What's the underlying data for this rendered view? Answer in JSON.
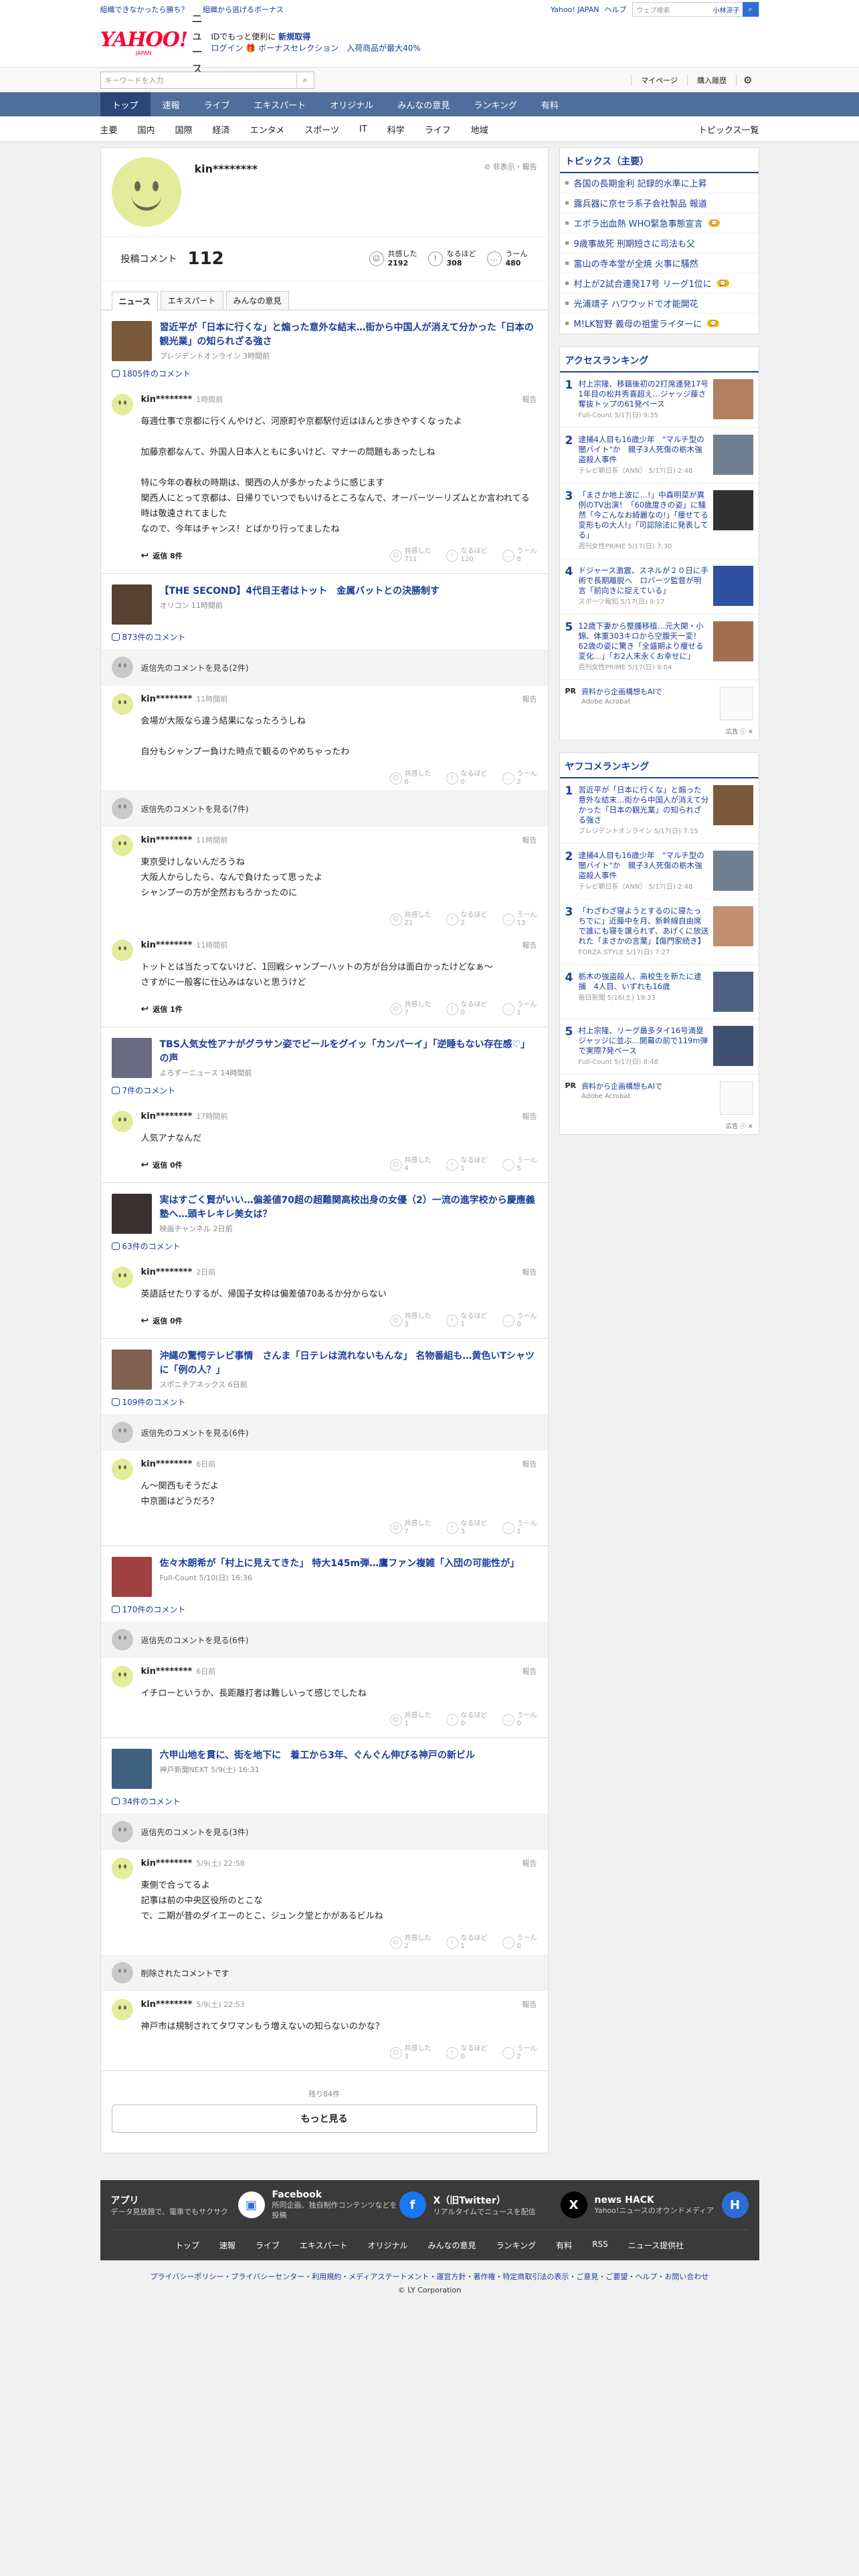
{
  "top": {
    "links": [
      "組織できなかったら勝ち？",
      "組織から逃げるボーナス"
    ],
    "yj": "Yahoo! JAPAN",
    "help": "ヘルプ",
    "search_placeholder": "ウェブ検索",
    "user": "小林涼子"
  },
  "header": {
    "logo": "YAHOO!",
    "logo_sub": "JAPAN",
    "news": "ニュース",
    "promo1": "IDでもっと便利に",
    "promo1b": "新規取得",
    "promo2": "ログイン 🎁 ボーナスセレクション　入荷商品が最大40%"
  },
  "search": {
    "placeholder": "キーワードを入力",
    "mypage": "マイページ",
    "history": "購入履歴"
  },
  "nav": [
    "トップ",
    "速報",
    "ライブ",
    "エキスパート",
    "オリジナル",
    "みんなの意見",
    "ランキング",
    "有料"
  ],
  "subnav": [
    "主要",
    "国内",
    "国際",
    "経済",
    "エンタメ",
    "スポーツ",
    "IT",
    "科学",
    "ライフ",
    "地域"
  ],
  "subnav_all": "トピックス一覧",
  "profile": {
    "name": "kin********",
    "report": "非表示・報告",
    "comments_label": "投稿コメント",
    "comments": "112",
    "r1": "共感した",
    "r1n": "2192",
    "r2": "なるほど",
    "r2n": "308",
    "r3": "うーん",
    "r3n": "480"
  },
  "tabs": [
    "ニュース",
    "エキスパート",
    "みんなの意見"
  ],
  "articles": [
    {
      "title": "習近平が「日本に行くな」と煽った意外な結末…街から中国人が消えて分かった「日本の観光業」の知られざる強さ",
      "src": "プレジデントオンライン 3時間前",
      "count": "1805件のコメント",
      "thumb": "#7a5a3a",
      "comments": [
        {
          "name": "kin********",
          "time": "1時間前",
          "text": "毎週仕事で京都に行くんやけど、河原町や京都駅付近はほんと歩きやすくなったよ\n\n加藤京都なんて、外国人日本人ともに多いけど、マナーの問題もあったしね\n\n特に今年の春秋の時期は、関西の人が多かったように感じます\n関西人にとって京都は、日帰りでいつでもいけるところなんで、オーバーツーリズムとか言われてる時は敬遠されてました\nなので、今年はチャンス！とばかり行ってましたね",
          "reply": "返信 8件",
          "r": [
            "711",
            "120",
            "8"
          ]
        }
      ]
    },
    {
      "title": "【THE SECOND】4代目王者はトット　金属バットとの決勝制す",
      "src": "オリコン 11時間前",
      "count": "873件のコメント",
      "thumb": "#5a4030",
      "more": "返信先のコメントを見る(2件)",
      "comments": [
        {
          "name": "kin********",
          "time": "11時間前",
          "text": "会場が大阪なら違う結果になったろうしね\n\n自分もシャンプー負けた時点で観るのやめちゃったわ",
          "reply": "",
          "r": [
            "6",
            "0",
            "2"
          ]
        }
      ],
      "more2": "返信先のコメントを見る(7件)",
      "comments2": [
        {
          "name": "kin********",
          "time": "11時間前",
          "text": "東京受けしないんだろうね\n大阪人からしたら、なんで負けたって思ったよ\nシャンプーの方が全然おもろかったのに",
          "reply": "",
          "r": [
            "21",
            "2",
            "13"
          ]
        },
        {
          "name": "kin********",
          "time": "11時間前",
          "text": "トットとは当たってないけど、1回戦シャンプーハットの方が台分は面白かったけどなぁ〜\nさすがに一般客に仕込みはないと思うけど",
          "reply": "返信 1件",
          "r": [
            "7",
            "0",
            "1"
          ]
        }
      ]
    },
    {
      "title": "TBS人気女性アナがグラサン姿でビールをグイッ「カンパーイ」「逆睡もない存在感♡」の声",
      "src": "よろずーニュース 14時間前",
      "count": "7件のコメント",
      "thumb": "#6a6a80",
      "comments": [
        {
          "name": "kin********",
          "time": "17時間前",
          "text": "人気アナなんだ",
          "reply": "返信 0件",
          "r": [
            "4",
            "1",
            "5"
          ]
        }
      ]
    },
    {
      "title": "実はすごく賢がいい…偏差値70超の超難関高校出身の女優（2）一流の進学校から慶應義塾へ…頭キレキレ美女は？",
      "src": "映画チャンネル 2日前",
      "count": "63件のコメント",
      "thumb": "#3a3030",
      "comments": [
        {
          "name": "kin********",
          "time": "2日前",
          "text": "英語話せたりするが、帰国子女枠は偏差値70あるか分からない",
          "reply": "返信 0件",
          "r": [
            "3",
            "1",
            "0"
          ]
        }
      ]
    },
    {
      "title": "沖縄の驚愕テレビ事情　さんま「日テレは流れないもんな」 名物番組も…黄色いTシャツに「例の人？」",
      "src": "スポニチアネックス 6日前",
      "count": "109件のコメント",
      "thumb": "#806050",
      "more": "返信先のコメントを見る(6件)",
      "comments": [
        {
          "name": "kin********",
          "time": "6日前",
          "text": "ん〜関西もそうだよ\n中京圏はどうだろ？",
          "reply": "",
          "r": [
            "7",
            "3",
            "1"
          ]
        }
      ]
    },
    {
      "title": "佐々木朗希が「村上に見えてきた」 特大145m弾…鷹ファン複雑「入団の可能性が」",
      "src": "Full-Count 5/10(日) 16:36",
      "count": "170件のコメント",
      "thumb": "#a04040",
      "more": "返信先のコメントを見る(6件)",
      "comments": [
        {
          "name": "kin********",
          "time": "6日前",
          "text": "イチローというか、長距離打者は難しいって感じでしたね",
          "reply": "",
          "r": [
            "1",
            "0",
            "0"
          ]
        }
      ]
    },
    {
      "title": "六甲山地を貫に、街を地下に　着工から3年、ぐんぐん伸びる神戸の新ビル",
      "src": "神戸新聞NEXT 5/9(土) 16:31",
      "count": "34件のコメント",
      "thumb": "#406080",
      "more": "返信先のコメントを見る(3件)",
      "comments": [
        {
          "name": "kin********",
          "time": "5/9(土) 22:58",
          "text": "東側で合ってるよ\n記事は前の中央区役所のとこな\nで、二期が昔のダイエーのとこ、ジュンク堂とかがあるビルね",
          "reply": "",
          "r": [
            "2",
            "1",
            "0"
          ]
        }
      ],
      "deleted": "削除されたコメントです",
      "comments2": [
        {
          "name": "kin********",
          "time": "5/9(土) 22:53",
          "text": "神戸市は規制されてタワマンもう増えないの知らないのかな？",
          "reply": "",
          "r": [
            "3",
            "0",
            "2"
          ]
        }
      ]
    }
  ],
  "rx": [
    "共感した",
    "なるほど",
    "うーん"
  ],
  "loadmore": {
    "rest": "残り84件",
    "btn": "もっと見る"
  },
  "side": {
    "topics_title": "トピックス（主要）",
    "topics": [
      "各国の長期金利 記録的水準に上昇",
      "露兵器に京セラ系子会社製品 報道",
      "エボラ出血熱 WHO緊急事態宣言",
      "9歳事故死 刑期短さに司法も父",
      "富山の寺本堂が全焼 火事に騒然",
      "村上が2試合連発17号 リーグ1位に",
      "光浦靖子 ハワウッドで才能開花",
      "M!LK智野 義母の祖霊ライターに"
    ],
    "badges": [
      2,
      5,
      7
    ],
    "access_title": "アクセスランキング",
    "access": [
      {
        "t": "村上宗隆、移籍後初の2打席連発17号　1年目の松井秀喜超え…ジャッジ藤さ奪抜トップの61発ペース",
        "s": "Full-Count 5/17(日) 9:35",
        "c": "#b08060"
      },
      {
        "t": "逮捕4人目も16歳少年　\"マルチ型の闇バイト\"か　親子3人死傷の栃木強盗殺人事件",
        "s": "テレビ朝日系（ANN） 5/17(日) 2:48",
        "c": "#708090"
      },
      {
        "t": "「まさか地上波に…!」中森明菜が異例のTV出演！「60歳度きの姿」に騒然「今こんなお綺麗なの!」「痩せてる変形もの大人!」「可認除法に発表してる」",
        "s": "週刊女性PRIME 5/17(日) 7:30",
        "c": "#303030"
      },
      {
        "t": "ドジャース激震、スネルが２０日に手術で長期離脱へ　ロバーツ監督が明言「前向きに捉えている」",
        "s": "スポーツ報知 5/17(日) 9:17",
        "c": "#3050a0"
      },
      {
        "t": "12歳下妻から整腫移植…元大関・小錦、体重303キロから空腹天一変！62歳の姿に驚き「全盛期より痩せる変化…」「お2人末永くお幸せに」",
        "s": "週刊女性PRIME 5/17(日) 8:04",
        "c": "#a07050"
      }
    ],
    "ad1": {
      "pr": "PR",
      "t": "資料から企画構想もAIで",
      "s": "Adobe Acrobat",
      "foot": "広告 ⓘ ✕"
    },
    "yafoko_title": "ヤフコメランキング",
    "yafoko": [
      {
        "t": "習近平が「日本に行くな」と煽った意外な結末…街から中国人が消えて分かった「日本の観光業」の知られざる強さ",
        "s": "プレジデントオンライン 5/17(日) 7:15",
        "c": "#7a5a3a"
      },
      {
        "t": "逮捕4人目も16歳少年　\"マルチ型の闇バイト\"か　親子3人死傷の栃木強盗殺人事件",
        "s": "テレビ朝日系（ANN） 5/17(日) 2:48",
        "c": "#708090"
      },
      {
        "t": "「わざわざ寝ようとするのに寝たっちでに」近藤中を月、新幹線自由席で誰にも寝を譲られず、あげくに放送れた「まさかの言葉」【傷門家続き】",
        "s": "FORZA STYLE 5/17(日) 7:27",
        "c": "#c09070"
      },
      {
        "t": "栃木の強盗殺人、高校生を新たに逮捕　4人目、いずれも16歳",
        "s": "毎日新聞 5/16(土) 19:33",
        "c": "#506080"
      },
      {
        "t": "村上宗隆、リーグ最多タイ16号満塁ジャッジに並ぶ…開幕の前で119m弾で実際7発ペース",
        "s": "Full-Count 5/17(日) 8:48",
        "c": "#405070"
      }
    ],
    "ad2": {
      "pr": "PR",
      "t": "資料から企画構想もAIで",
      "s": "Adobe Acrobat",
      "foot": "広告 ⓘ ✕"
    }
  },
  "footer": {
    "cards": [
      {
        "t": "アプリ",
        "s": "データ見放題で、電車でもサクサク",
        "c": "#ffffff",
        "g": "▣"
      },
      {
        "t": "Facebook",
        "s": "所同企画、独自制作コンテンツなどを投稿",
        "c": "#1877f2",
        "g": "f"
      },
      {
        "t": "X（旧Twitter）",
        "s": "リアルタイムでニュースを配信",
        "c": "#000000",
        "g": "X"
      },
      {
        "t": "news HACK",
        "s": "Yahoo!ニュースのオウンドメディア",
        "c": "#2d6ed6",
        "g": "H"
      }
    ],
    "nav": [
      "トップ",
      "速報",
      "ライブ",
      "エキスパート",
      "オリジナル",
      "みんなの意見",
      "ランキング",
      "有料",
      "RSS",
      "ニュース提供社"
    ],
    "links": "プライバシーポリシー・プライバシーセンター・利用規約・メディアステートメント・運営方針・著作権・特定商取引法の表示・ご意見・ご要望・ヘルプ・お問い合わせ",
    "copy": "© LY Corporation"
  }
}
